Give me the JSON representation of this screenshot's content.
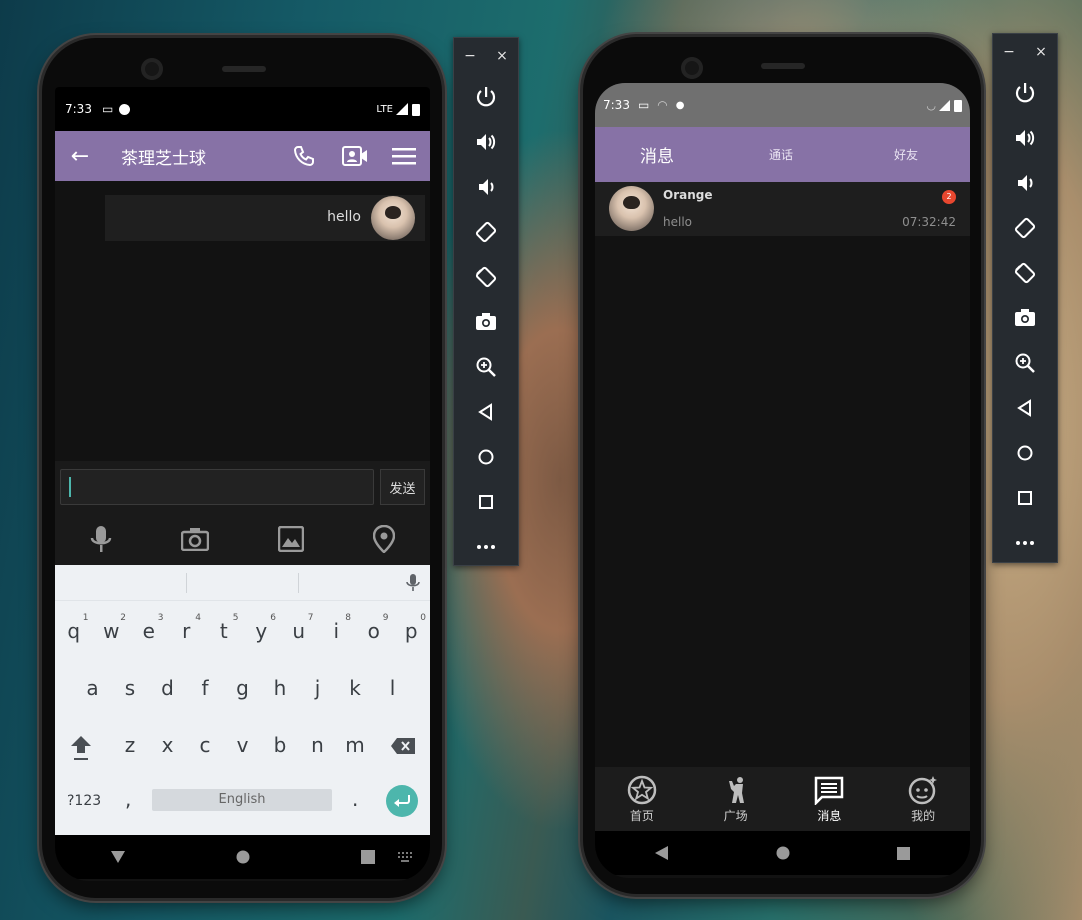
{
  "left_phone": {
    "status": {
      "time": "7:33",
      "network": "LTE"
    },
    "appbar": {
      "title": "茶理芝士球"
    },
    "messages": [
      {
        "text": "hello"
      }
    ],
    "input": {
      "value": "",
      "send_label": "发送"
    },
    "keyboard": {
      "row1": [
        {
          "k": "q",
          "n": "1"
        },
        {
          "k": "w",
          "n": "2"
        },
        {
          "k": "e",
          "n": "3"
        },
        {
          "k": "r",
          "n": "4"
        },
        {
          "k": "t",
          "n": "5"
        },
        {
          "k": "y",
          "n": "6"
        },
        {
          "k": "u",
          "n": "7"
        },
        {
          "k": "i",
          "n": "8"
        },
        {
          "k": "o",
          "n": "9"
        },
        {
          "k": "p",
          "n": "0"
        }
      ],
      "row2": [
        "a",
        "s",
        "d",
        "f",
        "g",
        "h",
        "j",
        "k",
        "l"
      ],
      "row3": [
        "z",
        "x",
        "c",
        "v",
        "b",
        "n",
        "m"
      ],
      "mode_key": "?123",
      "comma": ",",
      "space_label": "English",
      "period": "."
    }
  },
  "right_phone": {
    "status": {
      "time": "7:33"
    },
    "appbar": {
      "title": "消息",
      "tab_calls": "通话",
      "tab_friends": "好友"
    },
    "conversation": {
      "name": "Orange",
      "preview": "hello",
      "time": "07:32:42",
      "badge": "2"
    },
    "bottom_nav": [
      {
        "label": "首页",
        "icon": "star-icon"
      },
      {
        "label": "广场",
        "icon": "person-icon"
      },
      {
        "label": "消息",
        "icon": "message-icon",
        "active": true
      },
      {
        "label": "我的",
        "icon": "face-icon"
      }
    ]
  },
  "panel": {
    "min": "−",
    "close": "×"
  },
  "colors": {
    "accent": "#8772a6",
    "badge": "#e8472f",
    "send_fab": "#4db6ac"
  }
}
